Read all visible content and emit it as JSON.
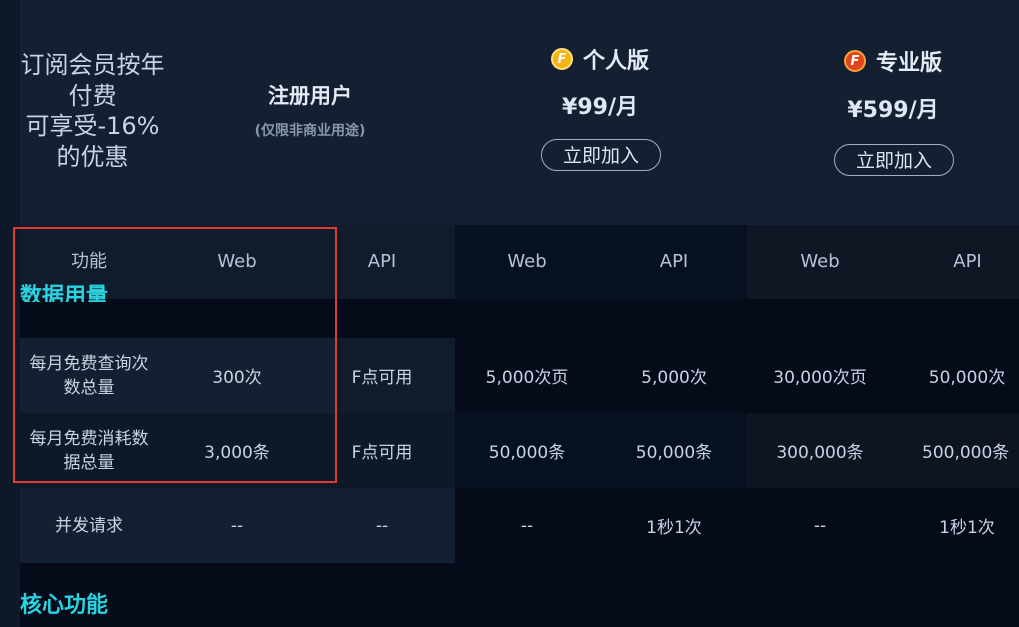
{
  "promo_text": [
    "订阅会员按年",
    "付费",
    "可享受-16%",
    "的优惠"
  ],
  "plans": {
    "free": {
      "title": "注册用户",
      "note": "(仅限非商业用途)"
    },
    "personal": {
      "title": "个人版",
      "coin_letter": "F",
      "price": "¥99/月",
      "button": "立即加入"
    },
    "pro": {
      "title": "专业版",
      "coin_letter": "F",
      "price": "¥599/月",
      "button": "立即加入"
    }
  },
  "columns": [
    "功能",
    "Web",
    "API",
    "Web",
    "API",
    "Web",
    "API"
  ],
  "sections": {
    "data_usage": "数据用量",
    "core_features": "核心功能"
  },
  "rows": [
    {
      "label": [
        "每月免费查询次",
        "数总量"
      ],
      "values": [
        "300次",
        "F点可用",
        "5,000次页",
        "5,000次",
        "30,000次页",
        "50,000次"
      ]
    },
    {
      "label": [
        "每月免费消耗数",
        "据总量"
      ],
      "values": [
        "3,000条",
        "F点可用",
        "50,000条",
        "50,000条",
        "300,000条",
        "500,000条"
      ]
    },
    {
      "label": [
        "并发请求"
      ],
      "values": [
        "--",
        "--",
        "--",
        "1秒1次",
        "--",
        "1秒1次"
      ]
    }
  ],
  "colors": {
    "page_bg": "#050b19",
    "header_bg": "#142032",
    "accent_cyan": "#29d3e0",
    "highlight_red": "#e0393c",
    "coin_gold": "#f4b416",
    "coin_red": "#e0461c"
  }
}
